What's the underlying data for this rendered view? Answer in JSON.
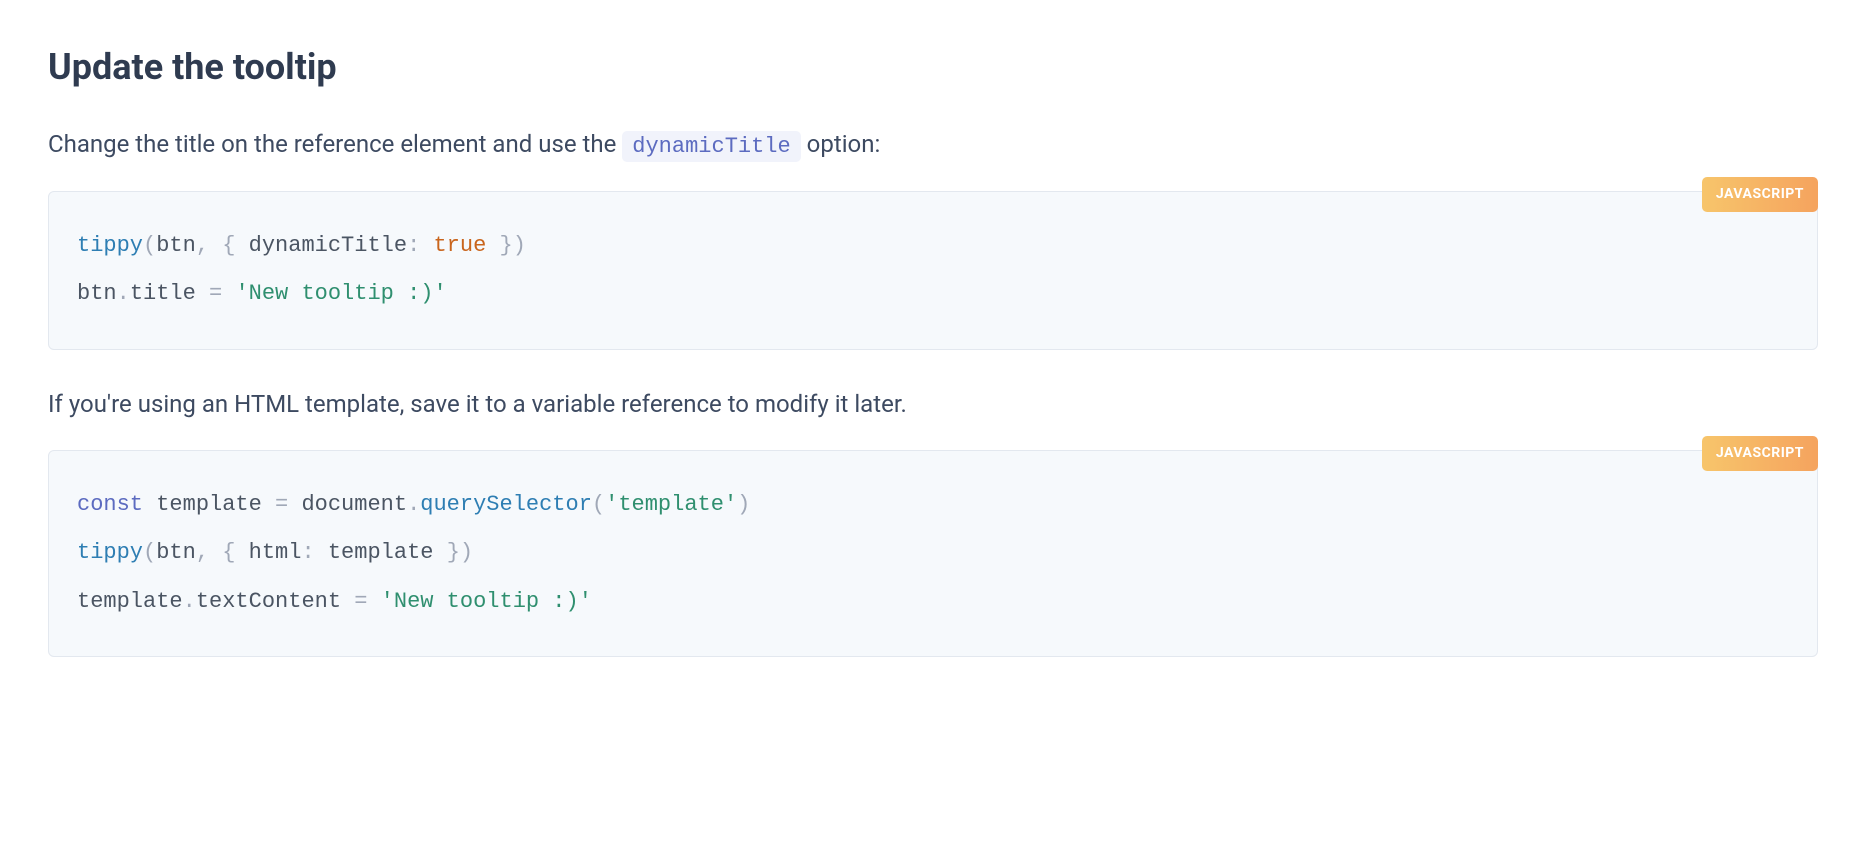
{
  "heading": "Update the tooltip",
  "para1_before": "Change the title on the reference element and use the ",
  "para1_code": "dynamicTitle",
  "para1_after": " option:",
  "badge1": "JAVASCRIPT",
  "code1": {
    "t1": "tippy",
    "t2": "(",
    "t3": "btn",
    "t4": ",",
    "t5": " ",
    "t6": "{",
    "t7": " dynamicTitle",
    "t8": ":",
    "t9": " ",
    "t10": "true",
    "t11": " ",
    "t12": "}",
    "t13": ")",
    "line2_a": "btn",
    "line2_b": ".",
    "line2_c": "title ",
    "line2_d": "=",
    "line2_e": " ",
    "line2_f": "'New tooltip :)'"
  },
  "para2": "If you're using an HTML template, save it to a variable reference to modify it later.",
  "badge2": "JAVASCRIPT",
  "code2": {
    "l1a": "const",
    "l1b": " template ",
    "l1c": "=",
    "l1d": " document",
    "l1e": ".",
    "l1f": "querySelector",
    "l1g": "(",
    "l1h": "'template'",
    "l1i": ")",
    "l2a": "tippy",
    "l2b": "(",
    "l2c": "btn",
    "l2d": ",",
    "l2e": " ",
    "l2f": "{",
    "l2g": " html",
    "l2h": ":",
    "l2i": " template ",
    "l2j": "}",
    "l2k": ")",
    "l3a": "template",
    "l3b": ".",
    "l3c": "textContent ",
    "l3d": "=",
    "l3e": " ",
    "l3f": "'New tooltip :)'"
  }
}
